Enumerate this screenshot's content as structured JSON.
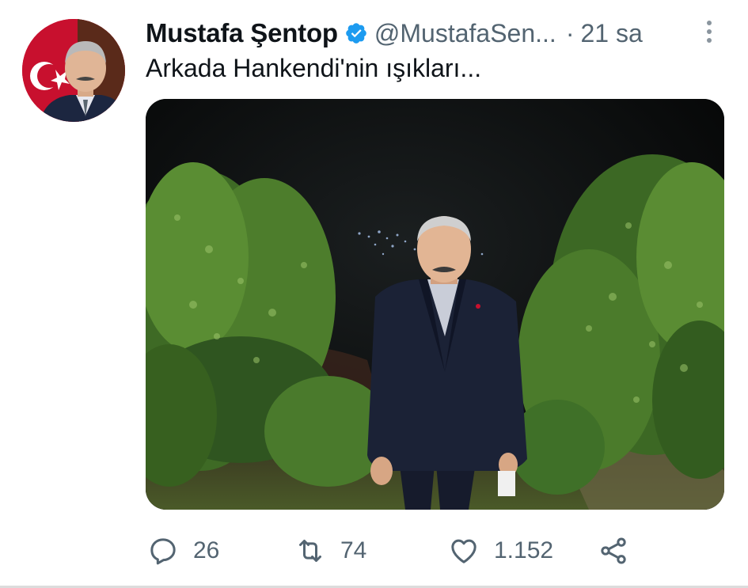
{
  "author": {
    "display_name": "Mustafa Şentop",
    "handle": "@MustafaSen...",
    "separator": "·",
    "time": "21 sa",
    "verified": true
  },
  "tweet": {
    "text": "Arkada Hankendi'nin ışıkları..."
  },
  "actions": {
    "reply_count": "26",
    "retweet_count": "74",
    "like_count": "1.152"
  },
  "icons": {
    "verified": "verified-badge-icon",
    "more": "more-vertical-icon",
    "reply": "reply-icon",
    "retweet": "retweet-icon",
    "like": "heart-icon",
    "share": "share-icon"
  },
  "colors": {
    "text_primary": "#0f1419",
    "text_secondary": "#536471",
    "verified_blue": "#1d9bf0"
  }
}
